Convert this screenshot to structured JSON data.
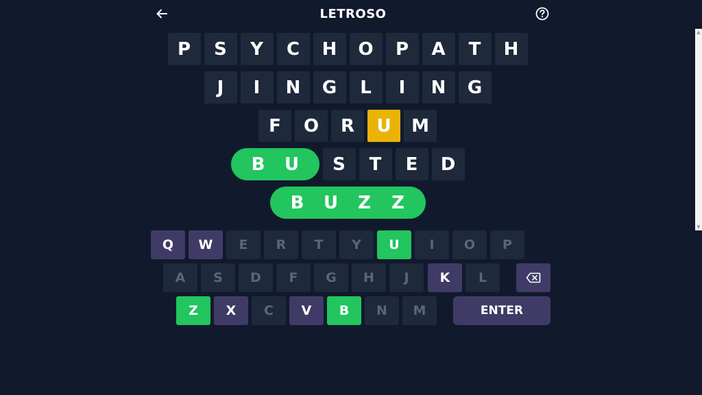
{
  "header": {
    "title": "LETROSO"
  },
  "board": {
    "row1": [
      "P",
      "S",
      "Y",
      "C",
      "H",
      "O",
      "P",
      "A",
      "T",
      "H"
    ],
    "row2": [
      "J",
      "I",
      "N",
      "G",
      "L",
      "I",
      "N",
      "G"
    ],
    "row3": [
      "F",
      "O",
      "R",
      "U",
      "M"
    ],
    "row4": [
      "B",
      "U",
      "S",
      "T",
      "E",
      "D"
    ],
    "row5": [
      "B",
      "U",
      "Z",
      "Z"
    ]
  },
  "keyboard": {
    "row1": [
      "Q",
      "W",
      "E",
      "R",
      "T",
      "Y",
      "U",
      "I",
      "O",
      "P"
    ],
    "row2": [
      "A",
      "S",
      "D",
      "F",
      "G",
      "H",
      "J",
      "K",
      "L"
    ],
    "row3": [
      "Z",
      "X",
      "C",
      "V",
      "B",
      "N",
      "M"
    ],
    "enter_label": "ENTER"
  },
  "colors": {
    "background": "#111a2c",
    "tile": "#1e293b",
    "present": "#eab308",
    "correct": "#22c55e",
    "used_key": "#3f3b66"
  }
}
